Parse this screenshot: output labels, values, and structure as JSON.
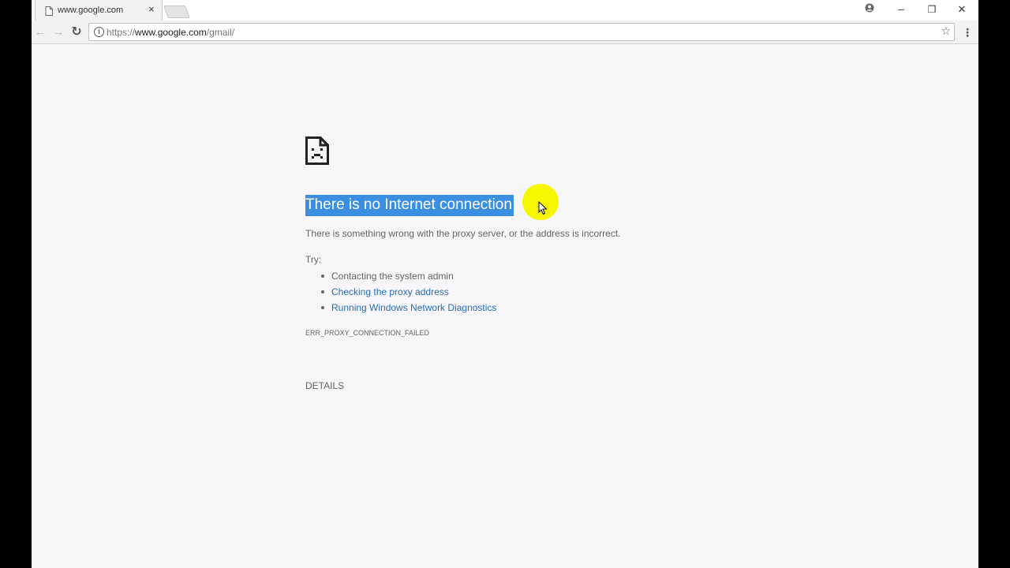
{
  "tab": {
    "title": "www.google.com",
    "close": "×"
  },
  "window_controls": {
    "profile": "●",
    "minimize": "–",
    "restore": "❐",
    "close": "✕"
  },
  "toolbar": {
    "back": "←",
    "forward": "→",
    "reload": "↻",
    "menu": "⋮"
  },
  "omnibox": {
    "info": "i",
    "url_scheme": "https://",
    "url_host": "www.google.com",
    "url_path": "/gmail/",
    "star": "☆"
  },
  "error_page": {
    "heading": "There is no Internet connection",
    "description": "There is something wrong with the proxy server, or the address is incorrect.",
    "try_label": "Try:",
    "suggestions": [
      "Contacting the system admin",
      "Checking the proxy address",
      "Running Windows Network Diagnostics"
    ],
    "error_code": "ERR_PROXY_CONNECTION_FAILED",
    "details_label": "DETAILS"
  },
  "colors": {
    "link": "#2a6bb8",
    "selection": "#3b8fe0",
    "cursor_highlight": "#f7f700",
    "body_text": "#646464"
  }
}
